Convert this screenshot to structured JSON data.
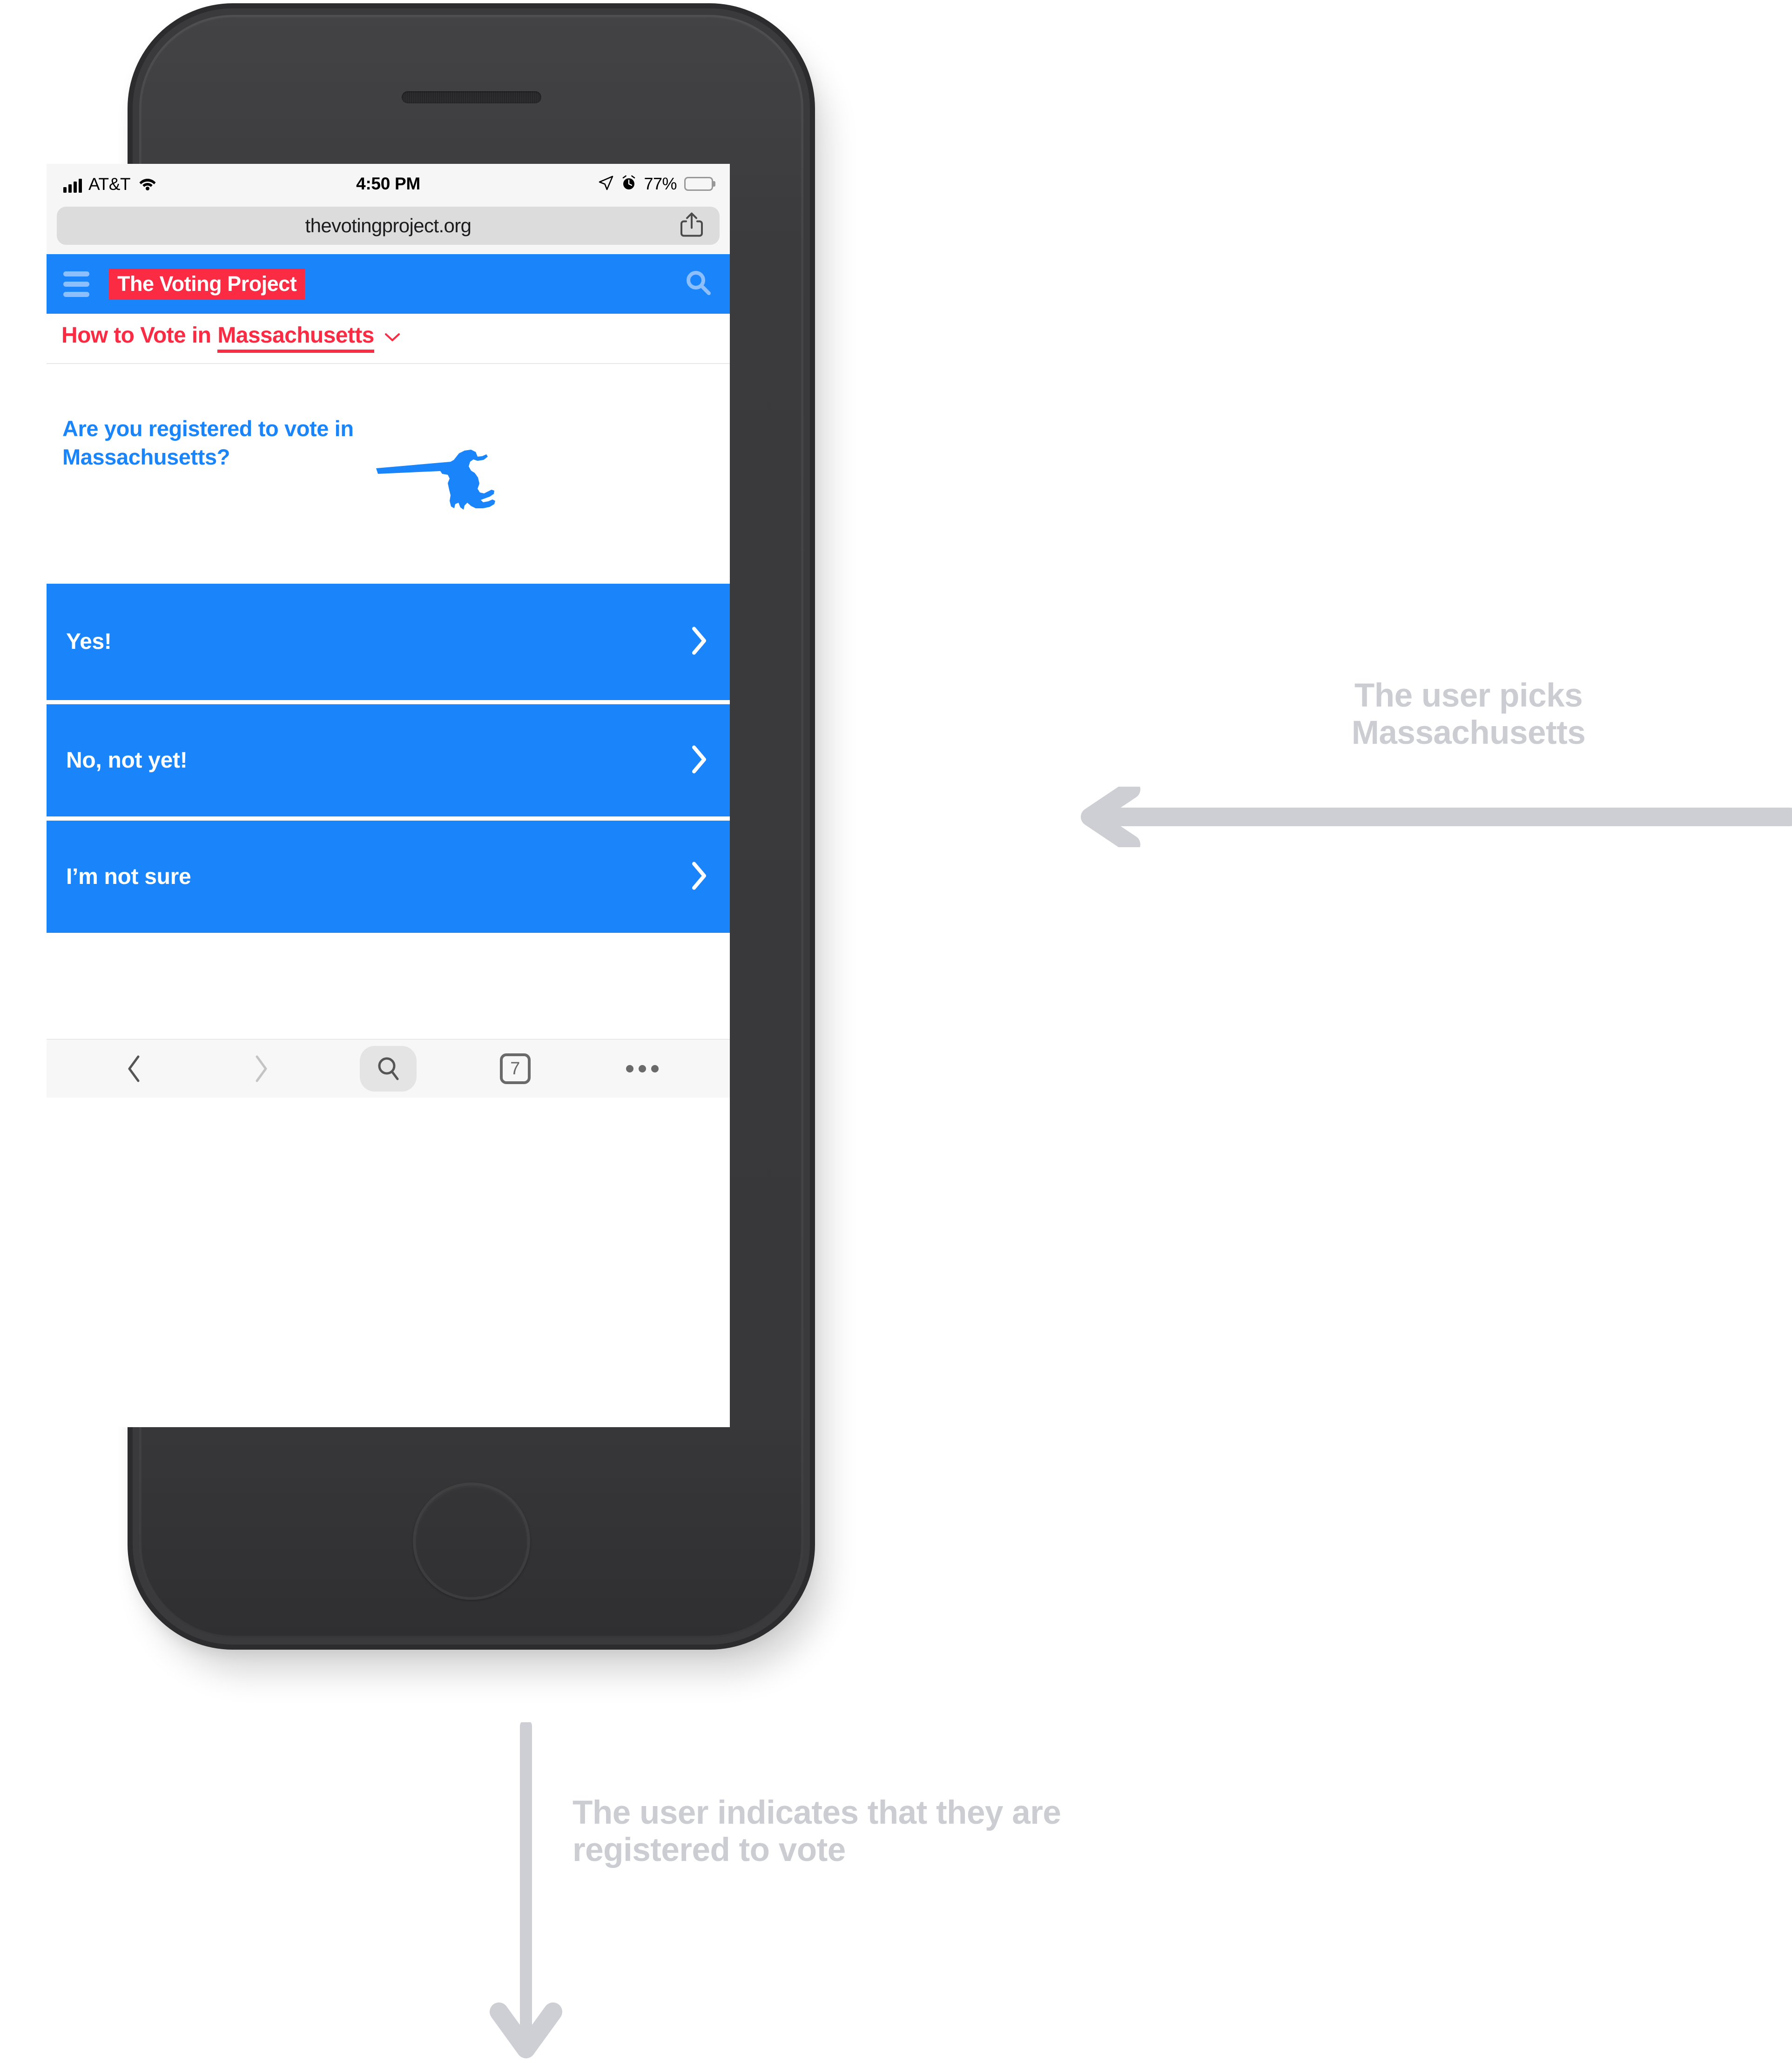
{
  "device": {
    "type": "smartphone-mockup",
    "home_button": "home-button"
  },
  "status_bar": {
    "carrier": "AT&T",
    "signal_icon": "signal-bars-icon",
    "wifi_icon": "wifi-icon",
    "time": "4:50 PM",
    "location_icon": "location-arrow-icon",
    "alarm_icon": "alarm-clock-icon",
    "battery_percent": "77%",
    "battery_icon": "battery-icon"
  },
  "browser": {
    "url": "thevotingproject.org",
    "share_icon": "share-icon",
    "toolbar": {
      "back_icon": "chevron-left-icon",
      "forward_icon": "chevron-right-icon",
      "search_icon": "search-icon",
      "tabs_icon": "tabs-icon",
      "tabs_count": "7",
      "more_icon": "more-dots-icon"
    }
  },
  "site_header": {
    "menu_icon": "hamburger-menu-icon",
    "logo_text": "The Voting Project",
    "search_icon": "search-icon",
    "background_color": "#1a85fb",
    "logo_background_color": "#fa2b42"
  },
  "state_selector": {
    "prefix": "How to Vote in",
    "state": "Massachusetts",
    "caret_icon": "chevron-down-icon",
    "color": "#fa2b42"
  },
  "question": {
    "text": "Are you registered to vote in Massachusetts?",
    "color": "#1a85fb",
    "state_map_icon": "massachusetts-map-icon"
  },
  "answers": [
    {
      "label": "Yes!",
      "chevron_icon": "chevron-right-icon"
    },
    {
      "label": "No, not yet!",
      "chevron_icon": "chevron-right-icon"
    },
    {
      "label": "I’m not sure",
      "chevron_icon": "chevron-right-icon"
    }
  ],
  "annotations": {
    "right": "The user picks Massachusetts",
    "bottom": "The user indicates that they are registered to vote",
    "arrow_color": "#cdcfd4",
    "left_arrow_icon": "arrow-left-icon",
    "down_arrow_icon": "arrow-down-icon"
  }
}
